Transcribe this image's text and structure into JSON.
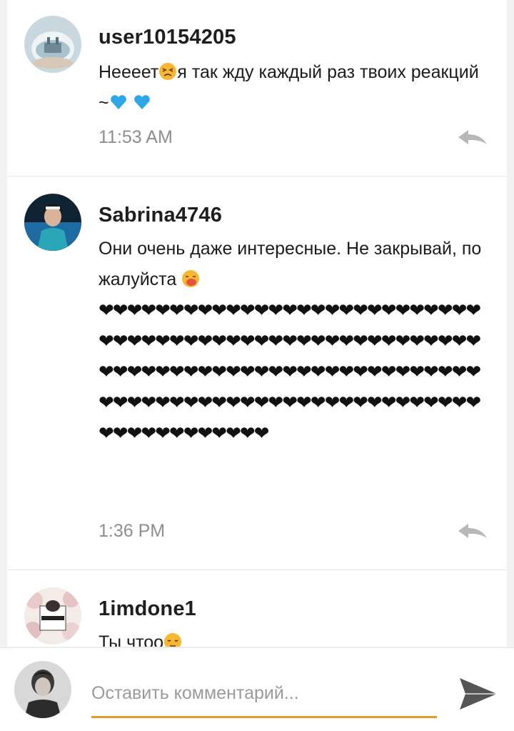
{
  "comments": [
    {
      "author": "user10154205",
      "text_before": "Нееeет",
      "text_after": "я так жду каждый раз твоих реакций~",
      "time": "11:53 AM"
    },
    {
      "author": "Sabrina4746",
      "text": "Они очень даже интересные. Не закрывай, пожалуйста",
      "hearts": "❤❤❤❤❤❤❤❤❤❤❤❤❤❤❤❤❤❤❤❤❤❤❤❤❤❤❤❤❤❤❤❤❤❤❤❤❤❤❤❤❤❤❤❤❤❤❤❤❤❤❤❤❤❤❤❤❤❤❤❤❤❤❤❤❤❤❤❤❤❤❤❤❤❤❤❤❤❤❤❤❤❤❤❤❤❤❤❤❤❤❤❤❤❤❤❤❤❤❤❤❤❤❤❤❤❤❤❤❤❤❤❤❤❤❤❤❤❤❤❤",
      "time": "1:36 PM"
    },
    {
      "author": "1imdone1",
      "text": "Ты чтоо"
    }
  ],
  "composer": {
    "placeholder": "Оставить комментарий..."
  },
  "colors": {
    "accent": "#e29b24",
    "timestamp": "#8e8e8e",
    "heart_blue": "#2ea7e8"
  },
  "icons": {
    "reply": "reply-arrow-icon",
    "send": "send-icon",
    "emoji_1": "persevering-face-emoji",
    "emoji_2": "blue-heart-emoji",
    "emoji_3": "sneezing-face-emoji",
    "emoji_4": "pensive-face-emoji"
  }
}
